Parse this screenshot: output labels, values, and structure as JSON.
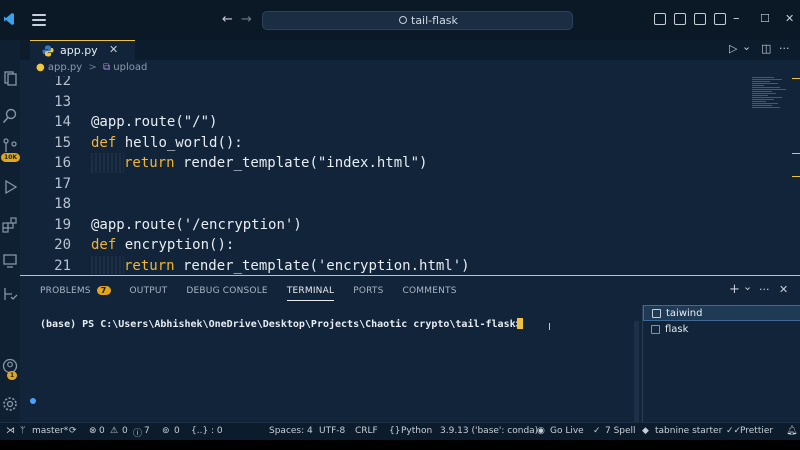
{
  "titlebar": {
    "back_glyph": "←",
    "forward_glyph": "→",
    "search_text": "tail-flask",
    "minimize_glyph": "–",
    "maximize_glyph": "☐",
    "close_glyph": "✕"
  },
  "activity": {
    "badge_source_control": "10K",
    "badge_accounts": "1"
  },
  "tab": {
    "label": "app.py",
    "close_glyph": "✕"
  },
  "editor_actions": {
    "run_glyph": "▷",
    "dropdown_glyph": "⌄",
    "split_glyph": "◫",
    "more_glyph": "···"
  },
  "breadcrumb": {
    "file": "app.py",
    "separator": ">",
    "symbol": "upload"
  },
  "code": {
    "lines": [
      {
        "num": "12",
        "text": ""
      },
      {
        "num": "13",
        "text": ""
      },
      {
        "num": "14",
        "pre": "@app.",
        "fn": "route",
        "post": "(\"/\")"
      },
      {
        "num": "15",
        "kw": "def",
        "post": " hello_world():"
      },
      {
        "num": "16",
        "kw": "return",
        "post": " render_template(\"index.html\")"
      },
      {
        "num": "17",
        "text": ""
      },
      {
        "num": "18",
        "text": ""
      },
      {
        "num": "19",
        "pre": "@app.",
        "fn": "route",
        "post": "('/encryption')"
      },
      {
        "num": "20",
        "kw": "def",
        "post": " encryption():"
      },
      {
        "num": "21",
        "kw": "return",
        "post": " render_template('encryption.html')"
      }
    ]
  },
  "panel": {
    "tabs": [
      "PROBLEMS",
      "OUTPUT",
      "DEBUG CONSOLE",
      "TERMINAL",
      "PORTS",
      "COMMENTS"
    ],
    "problems_count": "7",
    "active_tab": "TERMINAL",
    "add_glyph": "+",
    "chevron_glyph": "⌄",
    "more_glyph": "···",
    "close_glyph": "✕",
    "prompt": "(base) PS C:\\Users\\Abhishek\\OneDrive\\Desktop\\Projects\\Chaotic crypto\\tail-flask> ",
    "ibeam": "I",
    "terminals": [
      "taiwind",
      "flask"
    ]
  },
  "statusbar": {
    "branch": "master*",
    "errors": "0",
    "warnings": "0",
    "infos": "7",
    "ports": "0",
    "selection": "{..} : 0",
    "spaces": "Spaces: 4",
    "encoding": "UTF-8",
    "eol": "CRLF",
    "language": "Python",
    "interpreter": "3.9.13 ('base': conda)",
    "golive": "Go Live",
    "spell": "7 Spell",
    "tabnine": "tabnine starter",
    "prettier": "Prettier"
  },
  "colors": {
    "accent": "#f0c23a",
    "keyword": "#f2b632",
    "background": "#11243a"
  }
}
